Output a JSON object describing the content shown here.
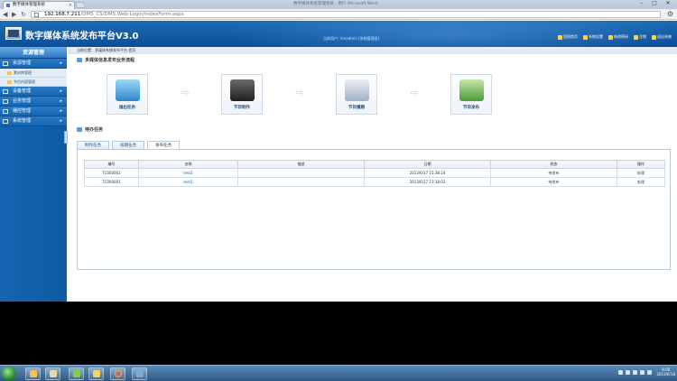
{
  "browser": {
    "tab_title": "数字媒体管理系统",
    "window_title": "数字媒体系统管理系统 - 用户 Microsoft Word",
    "url_host": "192.168.7.211",
    "url_path": "/DMS_CS/DMS.Web.Login/IndexForm.aspx",
    "close_glyph": "×",
    "nav_back": "◀",
    "nav_forward": "▶",
    "nav_reload": "↻",
    "min_glyph": "–",
    "max_glyph": "□",
    "winclose_glyph": "✕",
    "wrench_glyph": "⚙"
  },
  "header": {
    "app_title": "数字媒体系统发布平台V3.0",
    "welcome": "当前用户: Irmadmin [系统管理员]",
    "links": [
      "回到首页",
      "系统设置",
      "修改密码",
      "注销",
      "退出系统"
    ]
  },
  "sidebar": {
    "title": "资源管理",
    "sections": [
      {
        "label": "资源管理",
        "arrow": "▸"
      },
      {
        "label": "设备管理",
        "arrow": "▸"
      },
      {
        "label": "业务管理",
        "arrow": "▸"
      },
      {
        "label": "播控管理",
        "arrow": "▸"
      },
      {
        "label": "系统管理",
        "arrow": "▸"
      }
    ],
    "subitems": [
      "素材库管理",
      "节目内容管理"
    ]
  },
  "content": {
    "breadcrumb": "当前位置：多媒体系统发布平台 首页",
    "flow_title": "多媒体信息发布业务流程",
    "flow_steps": [
      "插出任务",
      "节目制作",
      "节目播期",
      "节目发布"
    ],
    "flow_arrow": "⇨",
    "task_title": "待办任务",
    "tabs": [
      "制作任务",
      "排期任务",
      "发布任务"
    ],
    "active_tab": 2,
    "table": {
      "headers": [
        "编号",
        "名称",
        "描述",
        "日期",
        "状态",
        "操作"
      ],
      "rows": [
        [
          "TC000002",
          "test2",
          "",
          "2013/6/17 15:38:24",
          "待发布",
          "处理"
        ],
        [
          "TC000001",
          "test1",
          "",
          "2013/6/17 13:18:02",
          "待发布",
          "处理"
        ]
      ]
    }
  },
  "taskbar": {
    "time": "9:08",
    "date": "2013/6/18"
  },
  "colors": {
    "header_blue": "#0c4e96",
    "sidebar_blue": "#1565b2",
    "link_blue": "#1f5aa8"
  }
}
